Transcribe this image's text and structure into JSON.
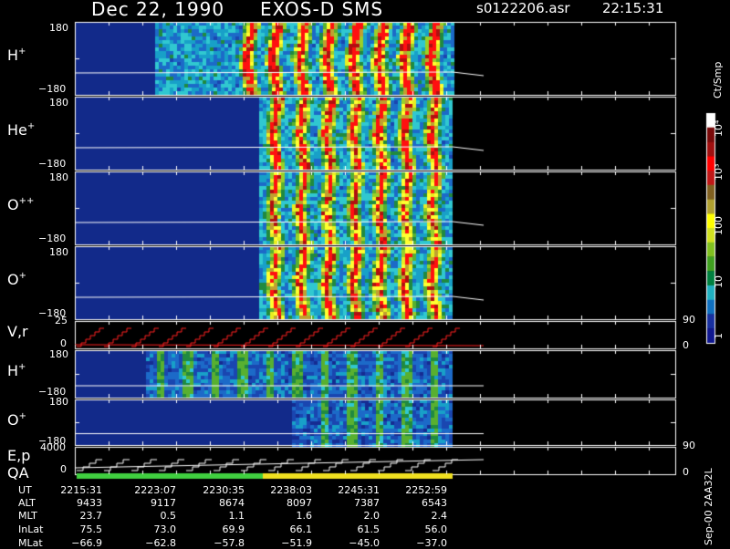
{
  "header": {
    "date": "Dec 22, 1990",
    "instrument": "EXOS-D SMS",
    "file": "s0122206.asr",
    "time": "22:15:31"
  },
  "panels": [
    {
      "id": "hplus",
      "species": "H",
      "charge": "+",
      "tick_top": "180",
      "tick_bottom": "−180"
    },
    {
      "id": "heplus",
      "species": "He",
      "charge": "+",
      "tick_top": "180",
      "tick_bottom": "−180"
    },
    {
      "id": "opp",
      "species": "O",
      "charge": "++",
      "tick_top": "180",
      "tick_bottom": "−180"
    },
    {
      "id": "oplus",
      "species": "O",
      "charge": "+",
      "tick_top": "180",
      "tick_bottom": "−180"
    }
  ],
  "vr_panel": {
    "label": "V,r",
    "tick_top": "25",
    "tick_mid": "0",
    "right_top": "90",
    "right_bottom": "0"
  },
  "small_panels": [
    {
      "id": "hplus2",
      "species": "H",
      "charge": "+",
      "tick_top": "180",
      "tick_bottom": "−180"
    },
    {
      "id": "oplus2",
      "species": "O",
      "charge": "+",
      "tick_top": "180",
      "tick_bottom": "−180"
    }
  ],
  "ep_panel": {
    "label": "E,p",
    "label2": "QA",
    "tick_top": "4000",
    "tick_mid": "0",
    "right_top": "90",
    "right_bottom": "0"
  },
  "colorbar": {
    "unit": "Ct/Smp",
    "ticks": [
      "10⁴",
      "10³",
      "100",
      "10",
      "1"
    ],
    "colors": [
      "#ffffff",
      "#7a0a0a",
      "#a01010",
      "#ff0000",
      "#c01818",
      "#806020",
      "#b0a030",
      "#ffff00",
      "#d0e020",
      "#80c020",
      "#40a020",
      "#008040",
      "#20b0c0",
      "#1070c0",
      "#1830a0",
      "#101890"
    ]
  },
  "version_note": "Sep-00  2AA32L",
  "footer": {
    "rows": [
      {
        "label": "UT",
        "values": [
          "2215:31",
          "2223:07",
          "2230:35",
          "2238:03",
          "2245:31",
          "2252:59"
        ]
      },
      {
        "label": "ALT",
        "values": [
          "9433",
          "9117",
          "8674",
          "8097",
          "7387",
          "6543"
        ]
      },
      {
        "label": "MLT",
        "values": [
          "23.7",
          "0.5",
          "1.1",
          "1.6",
          "2.0",
          "2.4"
        ]
      },
      {
        "label": "InLat",
        "values": [
          "75.5",
          "73.0",
          "69.9",
          "66.1",
          "61.5",
          "56.0"
        ]
      },
      {
        "label": "MLat",
        "values": [
          "−66.9",
          "−62.8",
          "−57.8",
          "−51.9",
          "−45.0",
          "−37.0"
        ]
      }
    ]
  },
  "chart_data": {
    "type": "heatmap",
    "title": "Dec 22, 1990   EXOS-D SMS",
    "x_ticks": [
      "2215:31",
      "2223:07",
      "2230:35",
      "2238:03",
      "2245:31",
      "2252:59"
    ],
    "y_range": [
      -180,
      180
    ],
    "colorbar_unit": "Ct/Smp",
    "colorbar_range": [
      "1",
      "10⁴"
    ],
    "series": [
      {
        "name": "H+"
      },
      {
        "name": "He+"
      },
      {
        "name": "O++"
      },
      {
        "name": "O+"
      }
    ]
  }
}
